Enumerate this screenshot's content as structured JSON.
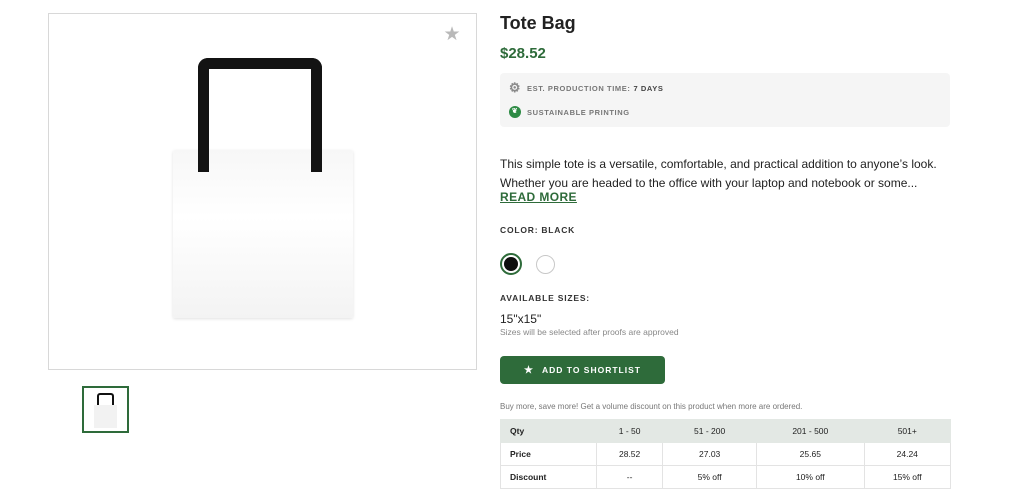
{
  "product": {
    "title": "Tote Bag",
    "price": "$28.52",
    "production_label": "EST. PRODUCTION TIME:",
    "production_value": "7 DAYS",
    "sustainable_label": "SUSTAINABLE PRINTING",
    "description_line1": "This simple tote is a versatile, comfortable, and practical addition to anyone’s look.",
    "description_line2": "Whether you are headed to the office with your laptop and notebook or some...",
    "read_more": "READ MORE"
  },
  "color": {
    "label": "COLOR:",
    "selected": "BLACK",
    "options": [
      "#0e0e0e",
      "#ffffff"
    ]
  },
  "sizes": {
    "label": "AVAILABLE SIZES:",
    "value": "15\"x15\"",
    "note": "Sizes will be selected after proofs are approved"
  },
  "actions": {
    "shortlist": "ADD TO SHORTLIST"
  },
  "volume": {
    "note": "Buy more, save more! Get a volume discount on this product when more are ordered.",
    "headers": [
      "Qty",
      "1 - 50",
      "51 - 200",
      "201 - 500",
      "501+"
    ],
    "price_row": [
      "Price",
      "28.52",
      "27.03",
      "25.65",
      "24.24"
    ],
    "discount_row": [
      "Discount",
      "--",
      "5% off",
      "10% off",
      "15% off"
    ]
  },
  "colors": {
    "accent": "#2e6b3a",
    "leaf": "#2e8b45"
  },
  "icons": [
    "star-icon",
    "gear-icon",
    "leaf-icon"
  ]
}
